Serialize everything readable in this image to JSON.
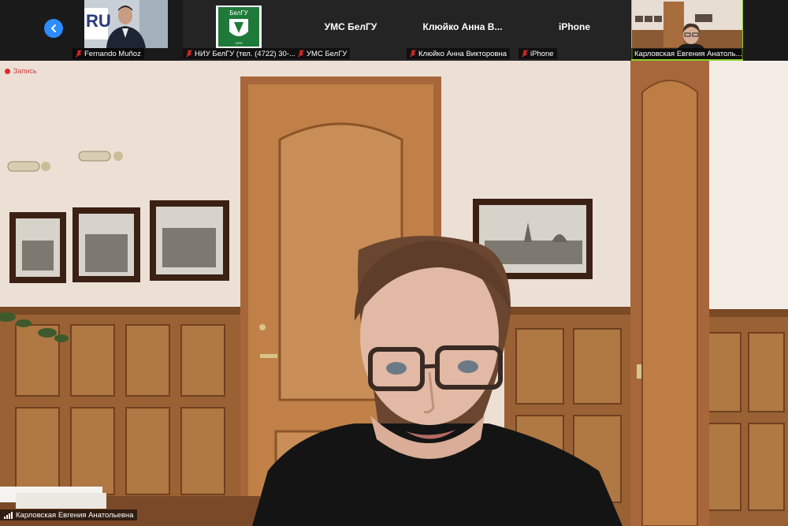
{
  "recording": {
    "label": "Запись"
  },
  "filmstrip": {
    "tiles": [
      {
        "name": "Fernando Muñoz",
        "center": ""
      },
      {
        "name": "НИУ БелГУ (тел. (4722) 30-...",
        "center": ""
      },
      {
        "name": "УМС БелГУ",
        "center": "УМС БелГУ"
      },
      {
        "name": "Клюйко Анна Викторовна",
        "center": "Клюйко Анна В..."
      },
      {
        "name": "iPhone",
        "center": "iPhone"
      },
      {
        "name": "Карловская Евгения Анатоль...",
        "center": ""
      }
    ],
    "logo_text": "БелГУ"
  },
  "main_speaker": {
    "name": "Карловская Евгения Анатольевна"
  },
  "colors": {
    "accent": "#2d8cff",
    "active_speaker": "#8cd12e",
    "mic_muted": "#e02828"
  }
}
